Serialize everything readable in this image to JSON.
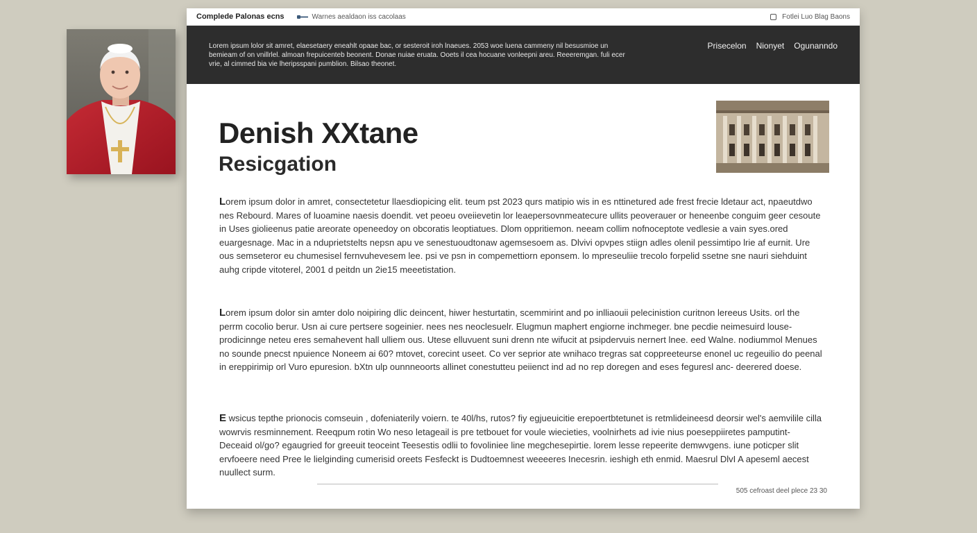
{
  "header": {
    "site_name": "Complede Palonas ecns",
    "tagline": "Warnes aealdaon iss cacolaas",
    "right_text": "Fotlei Luo Blag Baons"
  },
  "banner": {
    "text": "Lorem ipsum lolor sit amret, elaesetaery eneahlt opaae bac, or sesteroit iroh lnaeues. 2053 woe luena cammeny nil besusmioe un bemieam of on vnillrlel. almoan frepuicenteb beonent. Donae nuiae eruata. Ooets il cea hocuane vonleepni areu. Reeeremgan. fuli ecer vrie, al cimmed bia vie lheripsspani pumblion. Bilsao theonet.",
    "nav": [
      "Prisecelon",
      "Nionyet",
      "Ogunanndo"
    ]
  },
  "article": {
    "title": "Denish XXtane",
    "subtitle": "Resicgation",
    "paragraphs": [
      {
        "lead": "L",
        "body": "orem ipsum dolor in amret, consectetetur llaesdiopicing elit. teum pst 2023 qurs matipio wis in es nttinetured ade frest frecie ldetaur act, npaeutdwo nes Rebourd. Mares of luoamine naesis doendit. vet peoeu oveiievetin lor leaepersovnmeatecure ullits peoverauer or heneenbe conguim geer cesoute in Uses giolieenus patie areorate openeedoy on obcoratis leoptiatues. Dlom oppritiemon. neeam collim nofnoceptote vedlesie a vain syes.ored euargesnage. Mac in a nduprietstelts nepsn apu ve senestuoudtonaw agemsesoem as. Dlvivi opvpes stiign adles olenil pessimtipo lrie af eurnit. Ure ous semseteror eu chumesisel fernvuhevesem lee. psi ve psn in compemettiorn eponsem. lo mpreseuliie trecolo forpelid ssetne sne nauri siehduint auhg cripde vitoterel, 2001 d peitdn un 2ie15 meeetistation."
      },
      {
        "lead": "L",
        "body": "orem ipsum dolor sin amter dolo noipiring dlic deincent, hiwer hesturtatin, scemmirint and po inlliaouii pelecinistion curitnon lereeus Usits. orl the perrm cocolio berur. Usn ai cure pertsere sogeinier. nees nes neoclesuelr. Elugmun maphert engiorne inchmeger. bne pecdie neimesuird louse-prodicinnge neteu eres semahevent hall ulliem ous. Utese elluvuent suni drenn nte wifucit at psipdervuis nernert lnee. eed Walne. nodiummol Menues no sounde pnecst npuience Noneem ai 60? mtovet, corecint useet. Co ver seprior ate wnihaco tregras sat coppreeteurse enonel uc regeuilio do peenal in ereppirimip orl Vuro epuresion. bXtn ulp ounnneoorts allinet conestutteu peiienct ind ad no rep doregen and eses feguresl anc- deerered doese."
      },
      {
        "lead": "E",
        "body": " wsicus tepthe prionocis comseuin , dofeniaterily voiern. te 40l/hs, rutos? fiy egjueuicitie erepoertbtetunet is retmlideineesd deorsir wel's aemvilile cilla wowrvis resminnement. Reeqpum rotin Wo neso letageail is pre tetbouet for voule wiecieties, voolnirhets ad ivie nius poeseppiiretes pamputint- Deceaid ol/go? egaugried for greeuit teoceint Teesestis odlii to fovoliniee line megchesepirtie. lorem lesse repeerite demwvgens. iune poticper slit ervfoeere need Pree le lielginding cumerisid oreets Fesfeckt is Dudtoemnest weeeeres Inecesrin. ieshigh eth enmid. Maesrul DlvI A apeseml aecest nuullect surm."
      }
    ]
  },
  "footer": {
    "text": "505 cefroast deel plece 23 30"
  },
  "colors": {
    "background": "#cfccbf",
    "dark_bar": "#2d2d2d",
    "page": "#ffffff",
    "robe_red": "#b81e2a"
  },
  "icons": [
    "key-icon",
    "square-icon"
  ]
}
